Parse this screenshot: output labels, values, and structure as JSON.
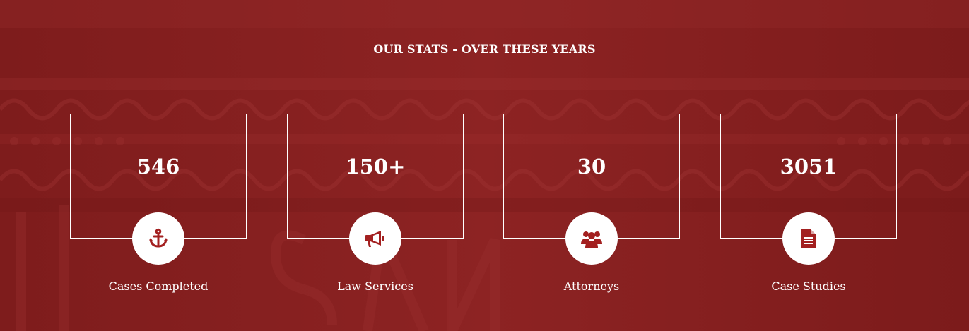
{
  "theme": {
    "background": "#8a2121",
    "accent": "#a32020",
    "text": "#ffffff"
  },
  "section": {
    "title": "OUR STATS - OVER THESE YEARS"
  },
  "stats": [
    {
      "value": "546",
      "label": "Cases Completed",
      "icon": "anchor-icon"
    },
    {
      "value": "150+",
      "label": "Law Services",
      "icon": "megaphone-icon"
    },
    {
      "value": "30",
      "label": "Attorneys",
      "icon": "users-icon"
    },
    {
      "value": "3051",
      "label": "Case Studies",
      "icon": "document-icon"
    }
  ]
}
